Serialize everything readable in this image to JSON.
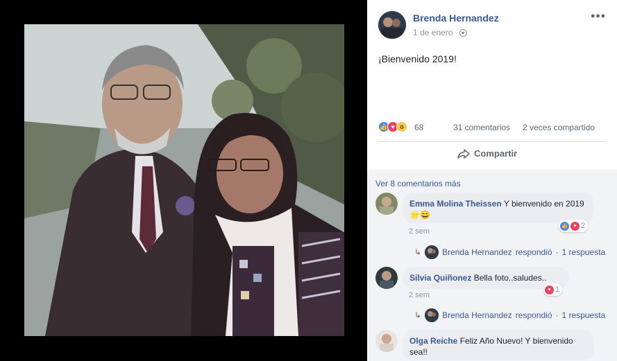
{
  "post": {
    "author": "Brenda Hernandez",
    "date": "1 de enero",
    "date_sep": "·",
    "text": "¡Bienvenido 2019!",
    "reaction_count": "68",
    "comments_count": "31 comentarios",
    "shares_count": "2 veces compartido",
    "share_label": "Compartir",
    "more_glyph": "•••"
  },
  "comments": {
    "view_more": "Ver 8 comentarios más",
    "items": [
      {
        "name": "Emma Molina Theissen",
        "text": "Y bienvenido en 2019 🌟😄",
        "time": "2 sem",
        "reaction_count": "2",
        "reply_author": "Brenda Hernandez",
        "reply_verb": "respondió",
        "reply_sep": "·",
        "reply_count": "1 respuesta"
      },
      {
        "name": "Silvia Quiñonez",
        "text": "Bella foto..saludes..",
        "time": "2 sem",
        "reaction_count": "1",
        "reply_author": "Brenda Hernandez",
        "reply_verb": "respondió",
        "reply_sep": "·",
        "reply_count": "1 respuesta"
      },
      {
        "name": "Olga Reiche",
        "text": "Feliz Año Nuevo! Y bienvenido sea!!"
      }
    ]
  },
  "icons": {
    "like": "like-icon",
    "love": "love-icon",
    "wow": "wow-icon",
    "share": "share-icon",
    "globe": "globe-icon",
    "reply": "reply-arrow-icon"
  },
  "colors": {
    "link": "#385898",
    "bubble": "#ebedf0",
    "muted": "#90949c",
    "like": "#4e8af5",
    "love": "#f0405f"
  }
}
